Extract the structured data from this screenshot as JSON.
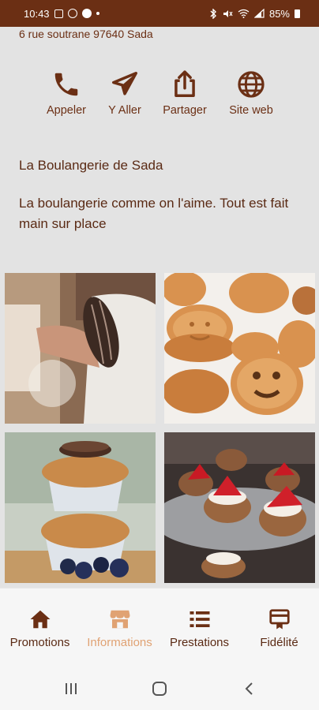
{
  "status_bar": {
    "time": "10:43",
    "battery_percent": "85%"
  },
  "address": "6 rue soutrane 97640 Sada",
  "actions": [
    {
      "label": "Appeler",
      "icon": "phone-icon"
    },
    {
      "label": "Y Aller",
      "icon": "navigation-arrow-icon"
    },
    {
      "label": "Partager",
      "icon": "share-icon"
    },
    {
      "label": "Site web",
      "icon": "globe-icon"
    }
  ],
  "business": {
    "name": "La Boulangerie de Sada",
    "description": "La boulangerie comme on l'aime. Tout est fait main sur place"
  },
  "gallery": [
    {
      "subject": "baker-with-bread"
    },
    {
      "subject": "smiley-cookies"
    },
    {
      "subject": "muffins-with-blueberries"
    },
    {
      "subject": "strawberry-tartlets"
    }
  ],
  "bottom_nav": {
    "active": "informations",
    "items": [
      {
        "label": "Promotions",
        "icon": "home-icon"
      },
      {
        "label": "Informations",
        "icon": "store-icon"
      },
      {
        "label": "Prestations",
        "icon": "list-icon"
      },
      {
        "label": "Fidélité",
        "icon": "loyalty-card-icon"
      }
    ]
  },
  "colors": {
    "brand": "#6b2f14",
    "text": "#5a2a14",
    "active_tab": "#e0a273",
    "background": "#e3e3e3"
  }
}
